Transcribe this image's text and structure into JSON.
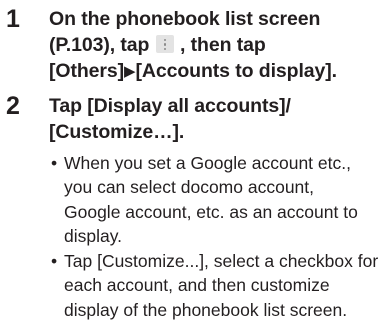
{
  "steps": [
    {
      "number": "1",
      "title_lines": [
        "On the phonebook list screen",
        "(P.103), tap",
        ", then tap",
        "[Others]",
        "[Accounts to display]."
      ],
      "menu_icon": "more-vertical-icon",
      "arrow_glyph": "▶"
    },
    {
      "number": "2",
      "title_lines": [
        "Tap [Display all accounts]/",
        "[Customize…]."
      ],
      "bullet_glyph": "•",
      "bullets": [
        {
          "lines": [
            "When you set a Google account etc.,",
            "you can select docomo account,",
            "Google account, etc. as an account to",
            "display."
          ]
        },
        {
          "lines": [
            "Tap [Customize...], select a checkbox for",
            "each account, and then customize",
            "display of the phonebook list screen."
          ]
        }
      ]
    }
  ]
}
